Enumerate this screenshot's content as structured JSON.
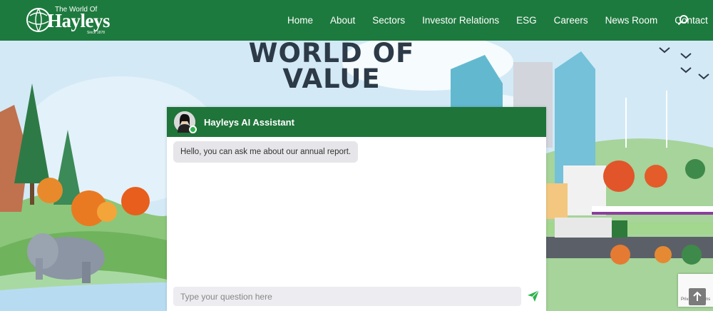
{
  "nav": {
    "logo_top": "The World Of",
    "logo_word": "Hayleys",
    "logo_since": "Since 1878",
    "items": [
      {
        "label": "Home"
      },
      {
        "label": "About"
      },
      {
        "label": "Sectors"
      },
      {
        "label": "Investor Relations"
      },
      {
        "label": "ESG"
      },
      {
        "label": "Careers"
      },
      {
        "label": "News Room"
      },
      {
        "label": "Contact"
      }
    ],
    "icon": "search-icon"
  },
  "hero": {
    "title_line1": "WORLD OF",
    "title_line2": "VALUE"
  },
  "chat": {
    "title": "Hayleys AI Assistant",
    "messages": [
      {
        "from": "assistant",
        "text": "Hello, you can ask me about our annual report."
      }
    ],
    "input_placeholder": "Type your question here",
    "send_icon": "send-icon"
  },
  "recaptcha": {
    "text": "Privacy - Terms"
  },
  "colors": {
    "brand_green": "#1d7a3e",
    "chat_header": "#1f743a",
    "send_green": "#2db34a"
  }
}
